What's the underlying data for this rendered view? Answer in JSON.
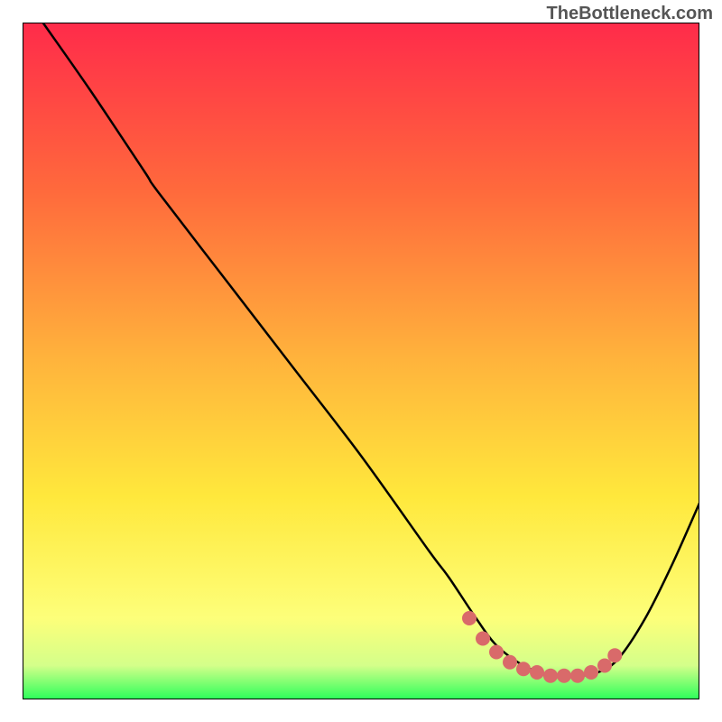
{
  "watermark": "TheBottleneck.com",
  "chart_data": {
    "type": "line",
    "title": "",
    "xlabel": "",
    "ylabel": "",
    "xlim": [
      0,
      100
    ],
    "ylim": [
      0,
      100
    ],
    "gradient_colors": [
      {
        "offset": 0,
        "color": "#ff2b4a"
      },
      {
        "offset": 25,
        "color": "#ff6a3c"
      },
      {
        "offset": 50,
        "color": "#ffb43c"
      },
      {
        "offset": 70,
        "color": "#ffe83c"
      },
      {
        "offset": 88,
        "color": "#fdff7a"
      },
      {
        "offset": 95,
        "color": "#d4ff8a"
      },
      {
        "offset": 100,
        "color": "#2bff5a"
      }
    ],
    "series": [
      {
        "name": "curve",
        "color": "#000000",
        "x": [
          3,
          10,
          18,
          20,
          30,
          40,
          50,
          60,
          63,
          67,
          70,
          74,
          78,
          82,
          85,
          88,
          92,
          96,
          100
        ],
        "y": [
          100,
          90,
          78,
          75,
          62,
          49,
          36,
          22,
          18,
          12,
          8,
          5,
          3.5,
          3.5,
          4,
          6,
          12,
          20,
          29
        ]
      },
      {
        "name": "highlight",
        "color": "#d96a6a",
        "x": [
          66,
          68,
          70,
          72,
          74,
          76,
          78,
          80,
          82,
          84,
          86,
          87.5
        ],
        "y": [
          12,
          9,
          7,
          5.5,
          4.5,
          4,
          3.5,
          3.5,
          3.5,
          4,
          5,
          6.5
        ]
      }
    ]
  }
}
